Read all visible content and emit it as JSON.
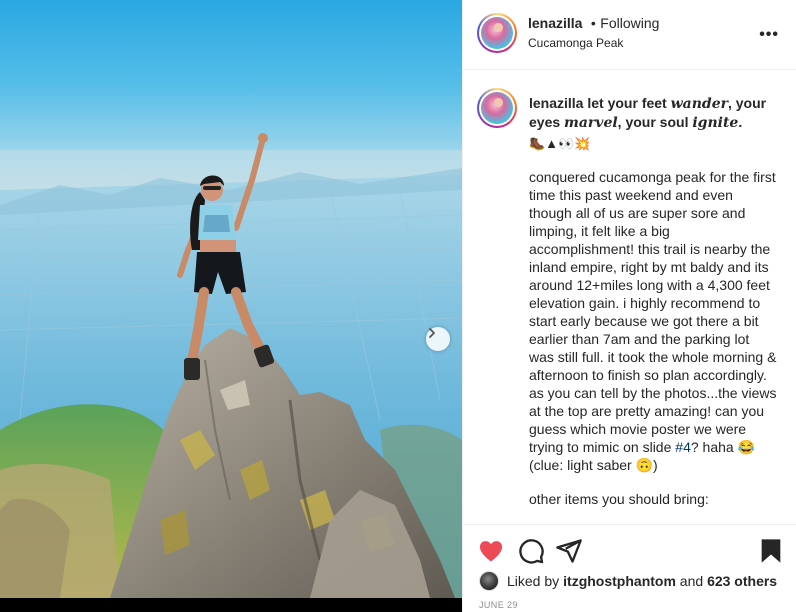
{
  "post": {
    "username": "lenazilla",
    "separator": "•",
    "follow_status": "Following",
    "location": "Cucamonga Peak",
    "more_icon": "more-horizontal-icon"
  },
  "caption": {
    "username": "lenazilla",
    "title_parts": [
      "let your feet ",
      "wander",
      ", your eyes ",
      "marvel",
      ", your soul ",
      "ignite",
      ". "
    ],
    "title_emojis": "🥾▲👀💥",
    "body": "conquered cucamonga peak for the first time this past weekend and even though all of us are super sore and limping, it felt like a big accomplishment! this trail is nearby the inland empire, right by mt baldy and its around 12+miles long with a 4,300 feet elevation gain. i highly recommend to start early because we got there a bit earlier than 7am and the parking lot was still full. it took the whole morning & afternoon to finish so plan accordingly. as you can tell by the photos...the views at the top are pretty amazing! can you guess which movie poster we were trying to mimic on slide",
    "hashtag": "#4",
    "body_tail": "? haha 😂(clue: light saber 🙃)",
    "next_para": "other items you should bring:"
  },
  "actions": {
    "like": "heart-icon",
    "comment": "comment-icon",
    "share": "share-icon",
    "save": "bookmark-icon",
    "like_color": "#ed4956"
  },
  "likes": {
    "prefix": "Liked by ",
    "user": "itzghostphantom",
    "middle": " and ",
    "others": "623 others"
  },
  "date": "JUNE 29"
}
